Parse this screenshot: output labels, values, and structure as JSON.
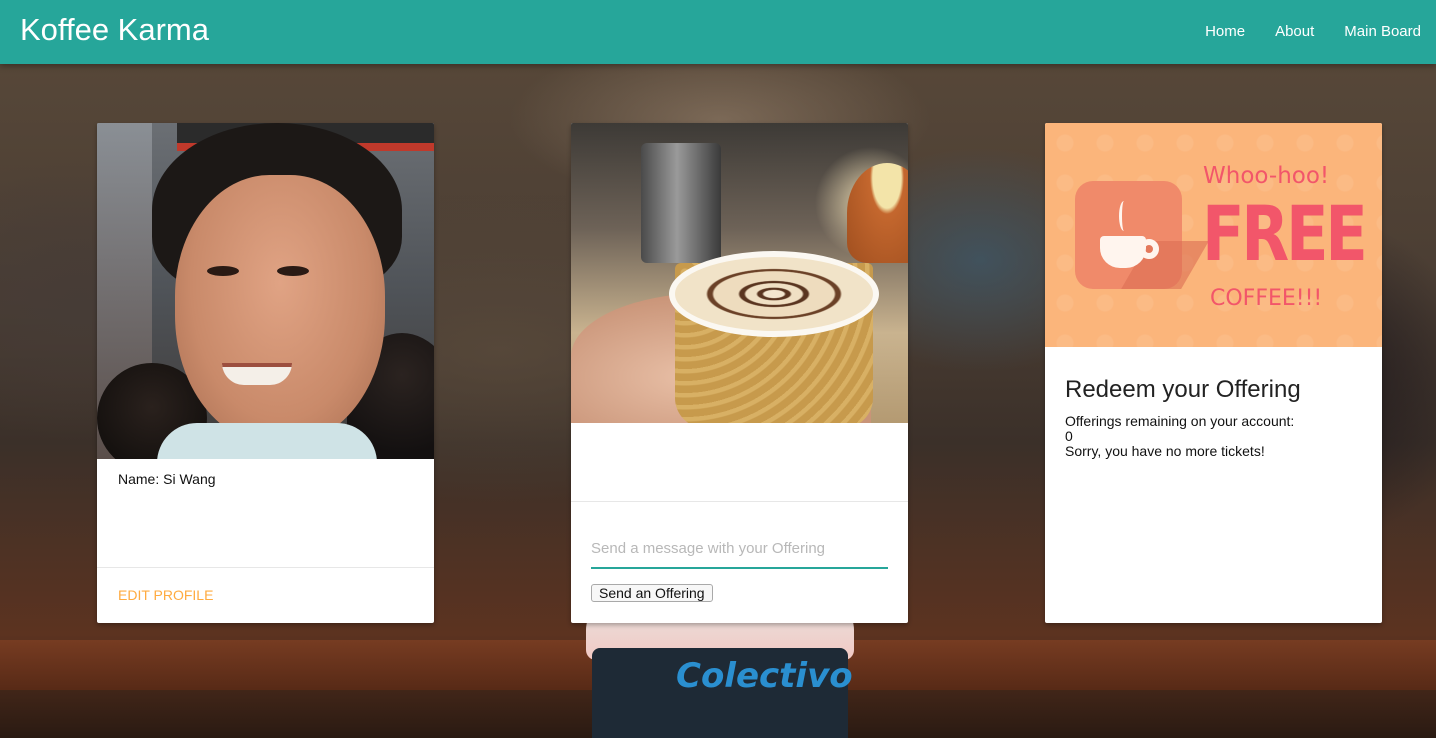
{
  "navbar": {
    "brand": "Koffee Karma",
    "links": [
      "Home",
      "About",
      "Main Board"
    ],
    "color": "#26a69a"
  },
  "profile_card": {
    "name_line": "Name: Si Wang",
    "action": "EDIT PROFILE",
    "action_color": "#ffab40"
  },
  "offering_card": {
    "message_placeholder": "Send a message with your Offering",
    "message_value": "",
    "send_button": "Send an Offering"
  },
  "redeem_card": {
    "banner": {
      "headline": "Whoo-hoo!",
      "big_text": "FREE",
      "sub_text": "COFFEE!!!",
      "icon": "coffee-mug-icon"
    },
    "title": "Redeem your Offering",
    "remaining_label": "Offerings remaining on your account:",
    "remaining_count": "0",
    "status_message": "Sorry, you have no more tickets!"
  },
  "background_cup_text": "Colectivo"
}
